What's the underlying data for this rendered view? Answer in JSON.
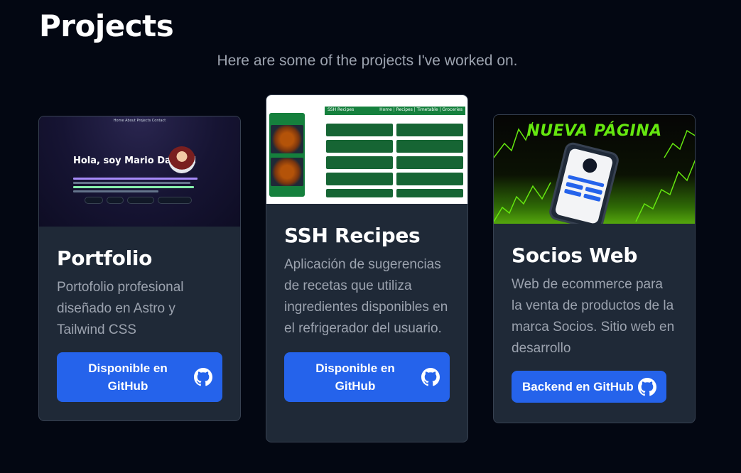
{
  "header": {
    "title": "Projects",
    "subtitle": "Here are some of the projects I've worked on."
  },
  "projects": [
    {
      "title": "Portfolio",
      "description": "Portofolio profesional diseñado en Astro y Tailwind CSS",
      "button_label": "Disponible en GitHub",
      "thumbnail": {
        "nav": "Home  About  Projects  Contact",
        "hero": "Hola, soy Mario Damas!"
      }
    },
    {
      "title": "SSH Recipes",
      "description": "Aplicación de sugerencias de recetas que utiliza ingredientes disponibles en el refrigerador del usuario.",
      "button_label": "Disponible en GitHub",
      "thumbnail": {
        "bar_title": "SSH Recipes",
        "bar_links": "Home | Recipes | Timetable | Groceries"
      }
    },
    {
      "title": "Socios Web",
      "description": "Web de ecommerce para la venta de productos de la marca Socios. Sitio web en desarrollo",
      "button_label": "Backend en GitHub",
      "thumbnail": {
        "headline": "NUEVA PÁGINA"
      }
    }
  ],
  "colors": {
    "background": "#030712",
    "card": "#1f2937",
    "accent": "#2563eb",
    "muted_text": "#9ca3af",
    "neon_green": "#65e70f"
  },
  "icons": {
    "button_icon": "github-icon"
  }
}
